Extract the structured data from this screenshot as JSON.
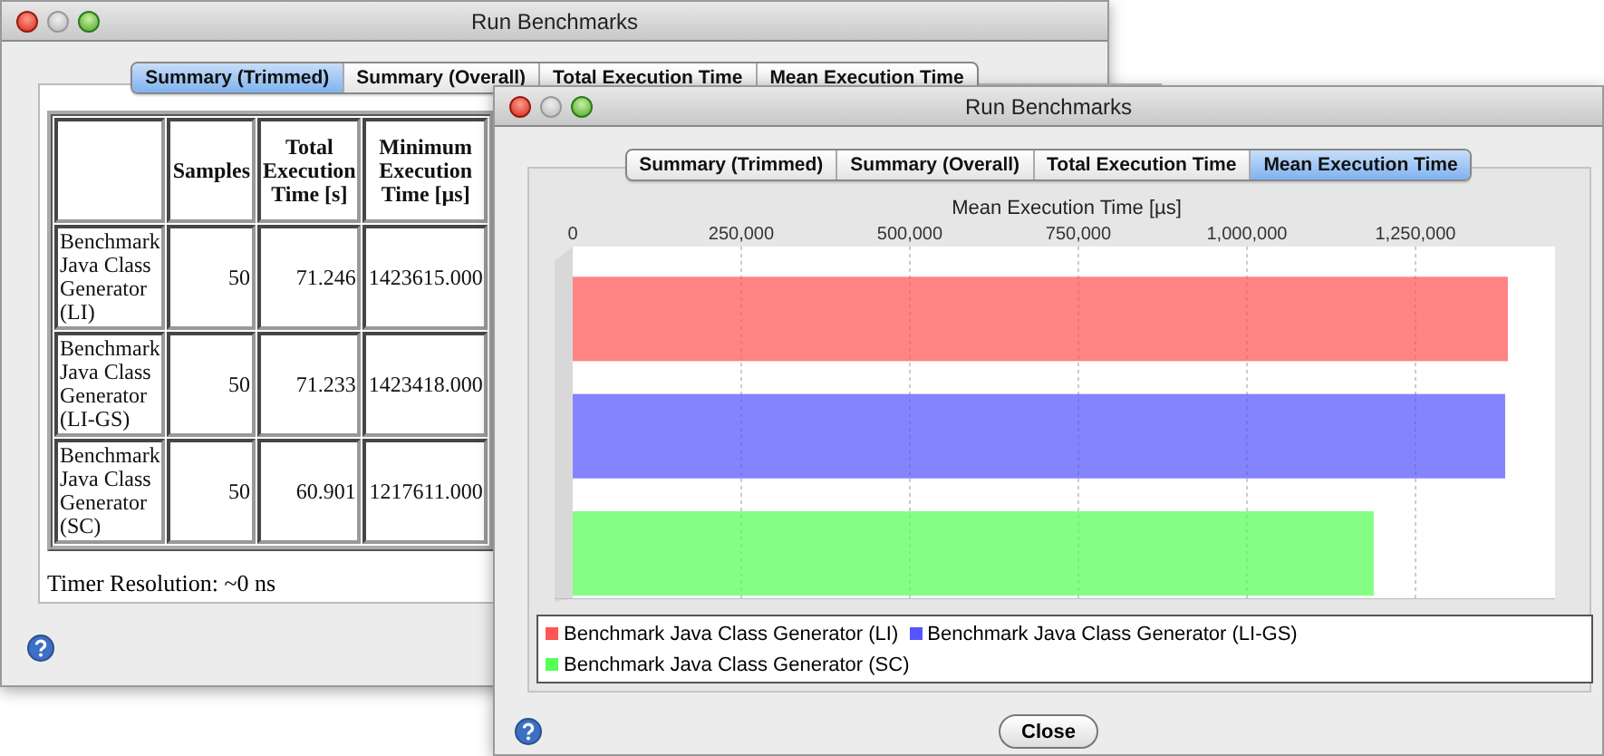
{
  "windows": [
    {
      "title": "Run Benchmarks",
      "tabs": [
        {
          "label": "Summary (Trimmed)",
          "selected": true
        },
        {
          "label": "Summary (Overall)",
          "selected": false
        },
        {
          "label": "Total Execution Time",
          "selected": false
        },
        {
          "label": "Mean Execution Time",
          "selected": false
        }
      ],
      "table": {
        "columns": [
          "Samples",
          "Total Execution Time [s]",
          "Minimum Execution Time [µs]"
        ],
        "rows": [
          {
            "name": "Benchmark Java Class Generator (LI)",
            "samples": "50",
            "total": "71.246",
            "minimum": "1423615.000"
          },
          {
            "name": "Benchmark Java Class Generator (LI-GS)",
            "samples": "50",
            "total": "71.233",
            "minimum": "1423418.000"
          },
          {
            "name": "Benchmark Java Class Generator (SC)",
            "samples": "50",
            "total": "60.901",
            "minimum": "1217611.000"
          }
        ]
      },
      "note": "Timer Resolution: ~0 ns"
    },
    {
      "title": "Run Benchmarks",
      "tabs": [
        {
          "label": "Summary (Trimmed)",
          "selected": false
        },
        {
          "label": "Summary (Overall)",
          "selected": false
        },
        {
          "label": "Total Execution Time",
          "selected": false
        },
        {
          "label": "Mean Execution Time",
          "selected": true
        }
      ],
      "chart_data": {
        "type": "bar",
        "orientation": "horizontal",
        "grid": true,
        "title": "Mean Execution Time [µs]",
        "xlim": [
          0,
          1457000
        ],
        "xticks": [
          {
            "value": 0,
            "label": "0"
          },
          {
            "value": 250000,
            "label": "250,000"
          },
          {
            "value": 500000,
            "label": "500,000"
          },
          {
            "value": 750000,
            "label": "750,000"
          },
          {
            "value": 1000000,
            "label": "1,000,000"
          },
          {
            "value": 1250000,
            "label": "1,250,000"
          }
        ],
        "series": [
          {
            "name": "Benchmark Java Class Generator (LI)",
            "color": "#ff5555",
            "values": [
              1387000
            ]
          },
          {
            "name": "Benchmark Java Class Generator (LI-GS)",
            "color": "#5555ff",
            "values": [
              1383000
            ]
          },
          {
            "name": "Benchmark Java Class Generator (SC)",
            "color": "#55ff55",
            "values": [
              1188000
            ]
          }
        ]
      },
      "button": "Close"
    }
  ]
}
